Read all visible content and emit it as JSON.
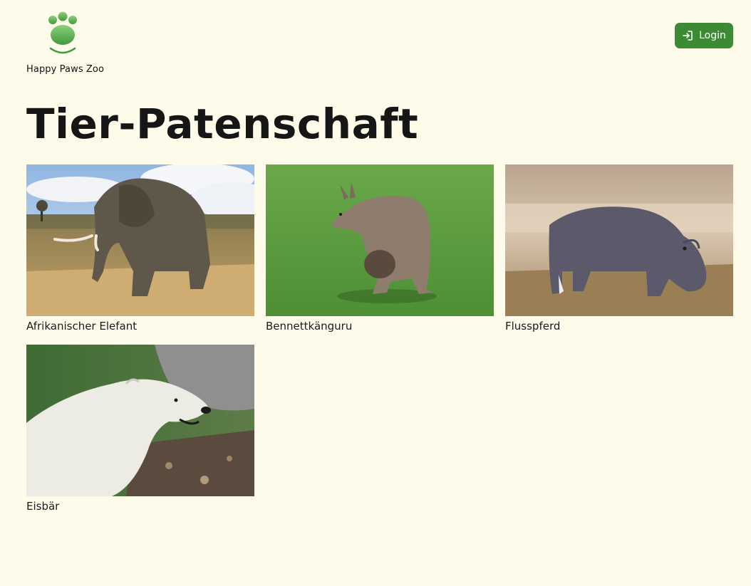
{
  "header": {
    "logo_text": "Happy Paws Zoo",
    "logo_icon": "paw-icon",
    "login_label": "Login",
    "login_icon": "login-arrow-icon"
  },
  "page_title": "Tier-Patenschaft",
  "animals": [
    {
      "name": "Afrikanischer Elefant",
      "image": "elephant-photo"
    },
    {
      "name": "Bennettkänguru",
      "image": "kangaroo-photo"
    },
    {
      "name": "Flusspferd",
      "image": "hippo-photo"
    },
    {
      "name": "Eisbär",
      "image": "polar-bear-photo"
    }
  ],
  "colors": {
    "background": "#fffbeb",
    "accent": "#3c8a34",
    "logo_green": "#5aab4c"
  }
}
